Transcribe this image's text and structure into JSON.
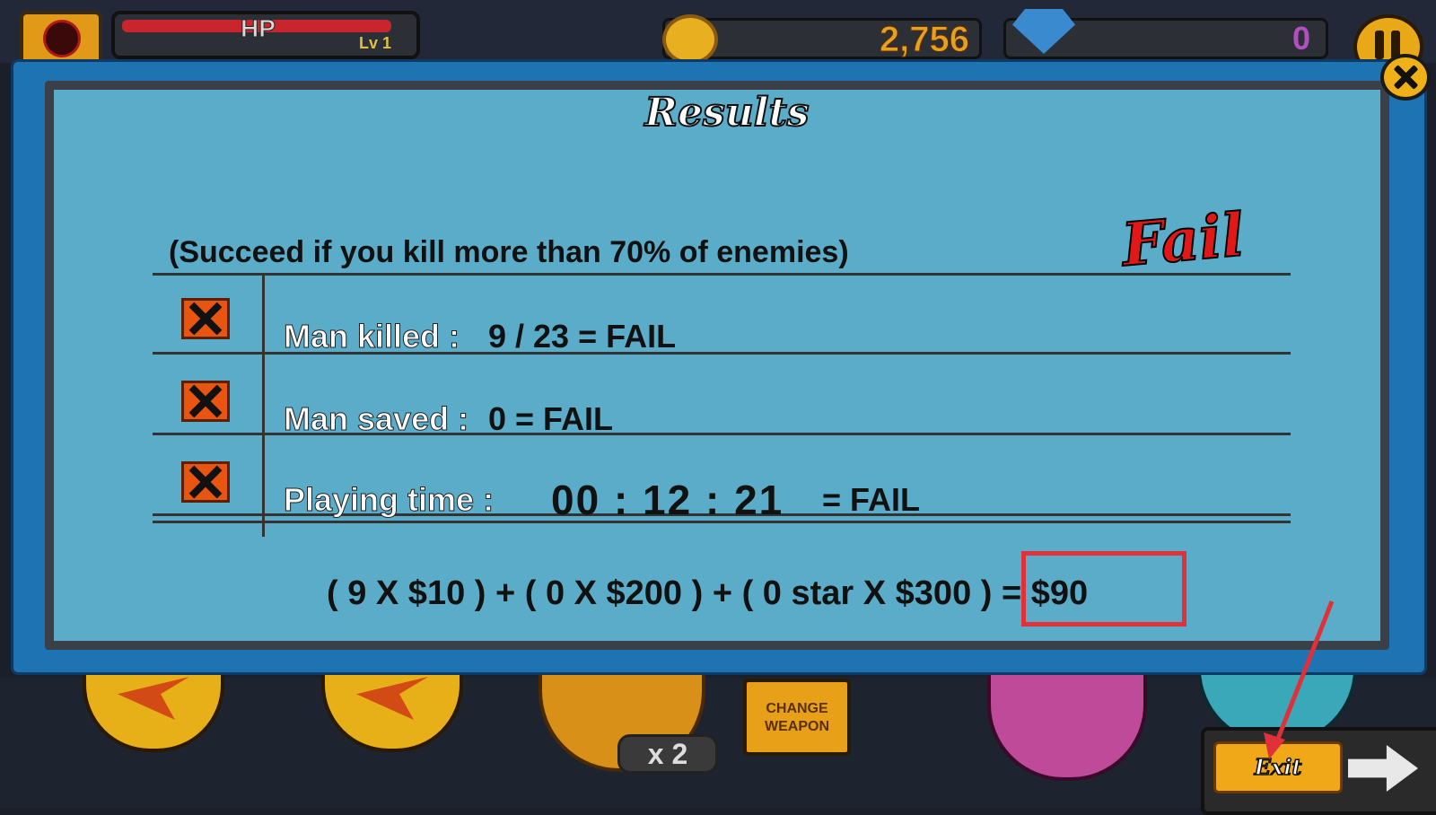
{
  "hud": {
    "hp_label": "HP",
    "level": "Lv 1",
    "coins": "2,756",
    "gems": "0"
  },
  "controls": {
    "skill_count": "x 2",
    "change_weapon_line1": "CHANGE",
    "change_weapon_line2": "WEAPON",
    "exit_label": "Exit"
  },
  "results": {
    "title": "Results",
    "outcome": "Fail",
    "condition": "(Succeed if you kill more than 70% of enemies)",
    "rows": [
      {
        "label": "Man killed :",
        "value": "9 / 23 =  FAIL",
        "status": "fail"
      },
      {
        "label": "Man saved :",
        "value": "0 = FAIL",
        "status": "fail"
      },
      {
        "label": "Playing time :",
        "time": "00 : 12 : 21",
        "value": "= FAIL",
        "status": "fail"
      }
    ],
    "formula": "( 9 X $10 ) + ( 0 X $200 ) + ( 0 star X $300 ) = $90"
  },
  "colors": {
    "fail_red": "#e01818",
    "highlight": "#e0303a",
    "dialog_bg": "#5bacc9",
    "accent_gold": "#f0a818"
  },
  "icons": [
    "coin-icon",
    "gem-icon",
    "pause-icon",
    "close-icon",
    "x-mark-icon",
    "right-arrow-icon"
  ]
}
